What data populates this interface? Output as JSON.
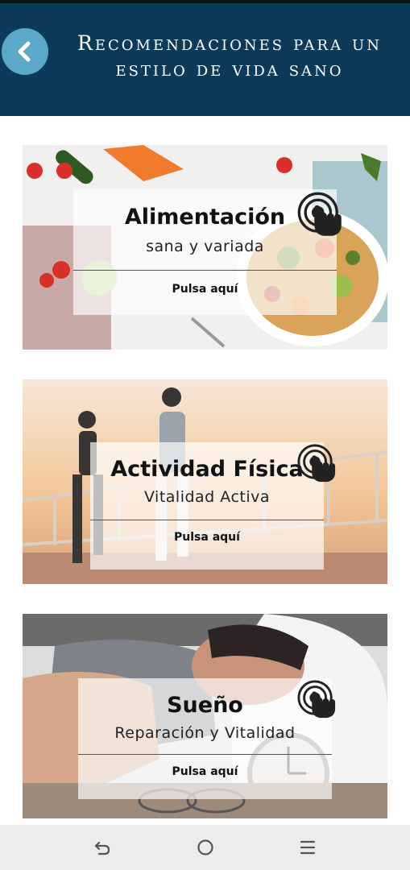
{
  "header": {
    "title_line1": "Recomendaciones para un",
    "title_line2": "estilo de vida sano",
    "back_icon": "chevron-left-icon",
    "colors": {
      "background": "#0e3a5a",
      "back_button": "#5aa9c8"
    }
  },
  "cards": [
    {
      "title": "Alimentación",
      "subtitle": "sana y variada",
      "cta": "Pulsa aquí",
      "icon": "tap-hand-icon",
      "image": "healthy-food-photo"
    },
    {
      "title": "Actividad Física",
      "subtitle": "Vitalidad Activa",
      "cta": "Pulsa aquí",
      "icon": "tap-hand-icon",
      "image": "runners-photo"
    },
    {
      "title": "Sueño",
      "subtitle": "Reparación y Vitalidad",
      "cta": "Pulsa aquí",
      "icon": "tap-hand-icon",
      "image": "sleeping-man-photo"
    }
  ],
  "navbar": {
    "icons": [
      "back-nav-icon",
      "home-icon",
      "recent-apps-icon"
    ]
  }
}
